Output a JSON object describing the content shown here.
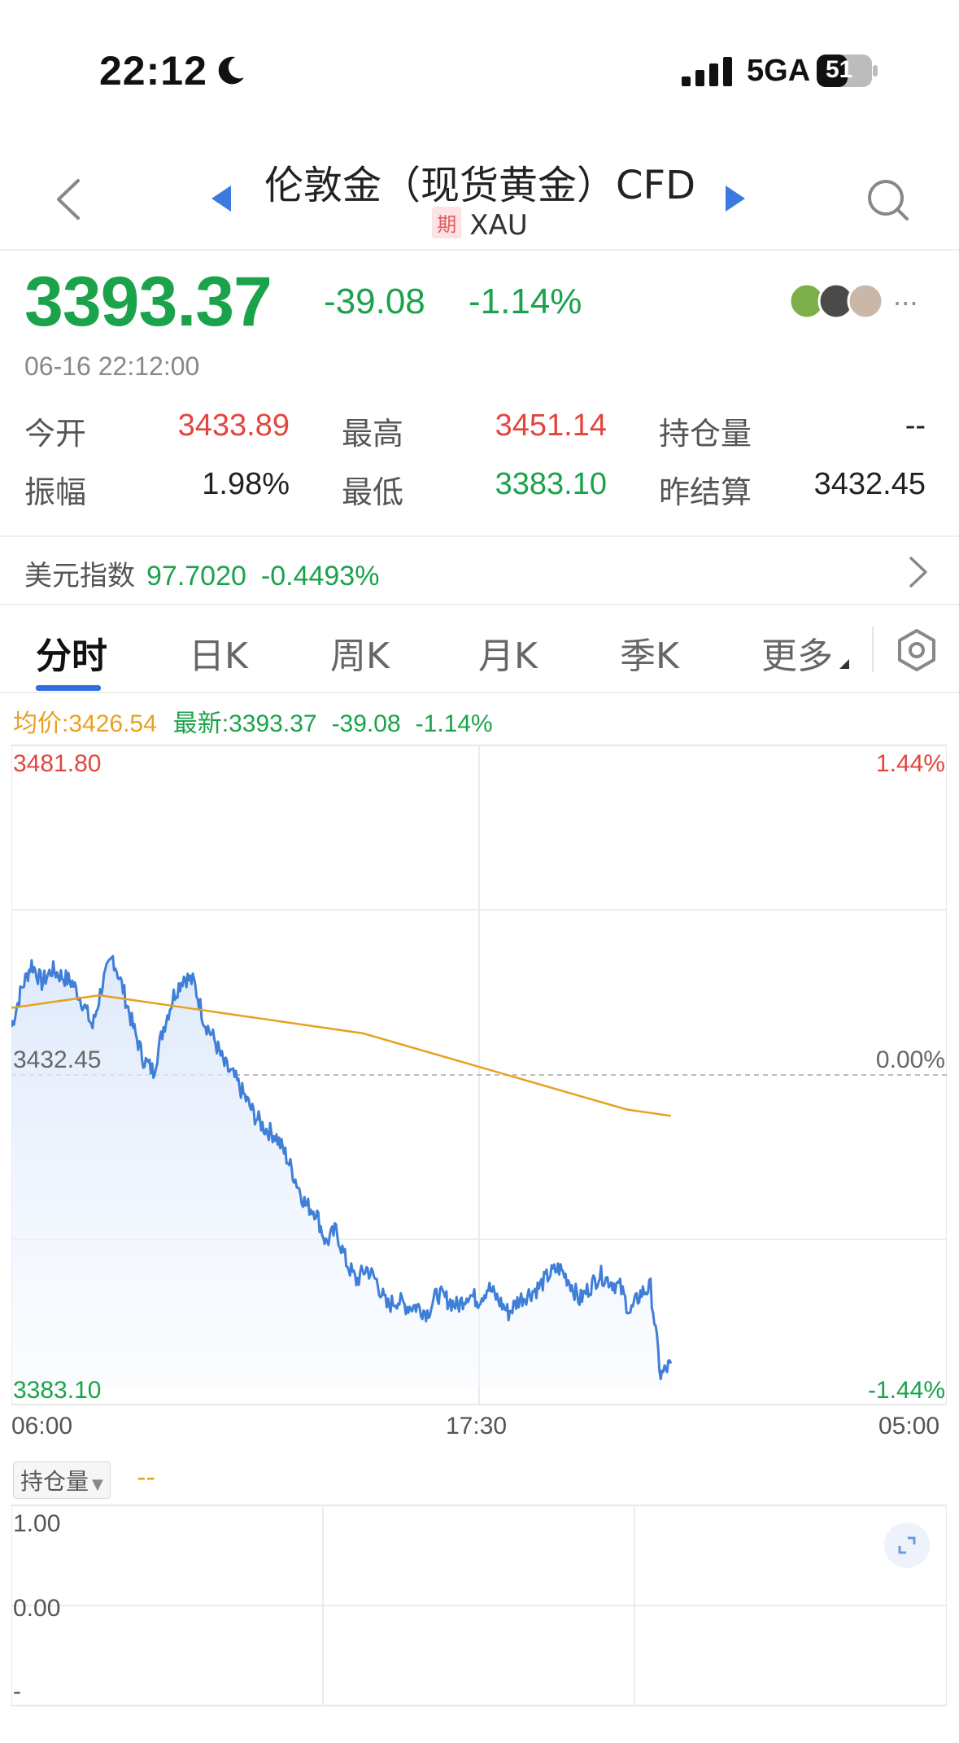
{
  "status": {
    "time": "22:12",
    "network": "5GA",
    "battery": "51"
  },
  "header": {
    "title": "伦敦金（现货黄金）CFD",
    "tag": "期",
    "symbol": "XAU"
  },
  "quote": {
    "price": "3393.37",
    "change": "-39.08",
    "change_pct": "-1.14%",
    "timestamp": "06-16 22:12:00",
    "more": "···",
    "stats": {
      "open_label": "今开",
      "open": "3433.89",
      "high_label": "最高",
      "high": "3451.14",
      "oi_label": "持仓量",
      "oi": "--",
      "amp_label": "振幅",
      "amp": "1.98%",
      "low_label": "最低",
      "low": "3383.10",
      "prev_label": "昨结算",
      "prev": "3432.45"
    }
  },
  "usd_index": {
    "label": "美元指数",
    "value": "97.7020",
    "change": "-0.4493%"
  },
  "tabs": [
    "分时",
    "日K",
    "周K",
    "月K",
    "季K",
    "更多"
  ],
  "legend": {
    "avg": "均价:3426.54",
    "latest": "最新:3393.37",
    "change": "-39.08",
    "pct": "-1.14%"
  },
  "chart_data": {
    "type": "line",
    "x_labels": [
      "06:00",
      "17:30",
      "05:00"
    ],
    "y_left": {
      "max": "3481.80",
      "mid": "3432.45",
      "min": "3383.10"
    },
    "y_right": {
      "max": "1.44%",
      "mid": "0.00%",
      "min": "-1.44%"
    },
    "ylim": [
      3383.1,
      3481.8
    ],
    "session_fraction_elapsed": 0.705,
    "series": [
      {
        "color": "#3f7fd8",
        "values": [
          3440,
          3446,
          3450,
          3447,
          3449,
          3448,
          3447,
          3444,
          3440,
          3447,
          3451,
          3446,
          3440,
          3435,
          3433,
          3440,
          3445,
          3448,
          3447,
          3441,
          3438,
          3434,
          3432,
          3429,
          3426,
          3424,
          3423,
          3420,
          3416,
          3412,
          3411,
          3406,
          3408,
          3403,
          3400,
          3402,
          3400,
          3396,
          3397,
          3396,
          3396,
          3395,
          3398,
          3397,
          3396,
          3398,
          3397,
          3399,
          3397,
          3395,
          3397,
          3398,
          3399,
          3401,
          3402,
          3400,
          3397,
          3399,
          3401,
          3400,
          3399,
          3395,
          3398,
          3399,
          3385,
          3387
        ]
      },
      {
        "color": "#e8a020",
        "values": [
          3443,
          3444,
          3445,
          3444,
          3443,
          3442,
          3441,
          3440,
          3439,
          3437,
          3435,
          3433,
          3431,
          3429,
          3427,
          3426
        ]
      }
    ]
  },
  "volume": {
    "selector": "持仓量",
    "value": "--",
    "y_max": "1.00",
    "y_zero": "0.00",
    "y_neg": "-"
  }
}
